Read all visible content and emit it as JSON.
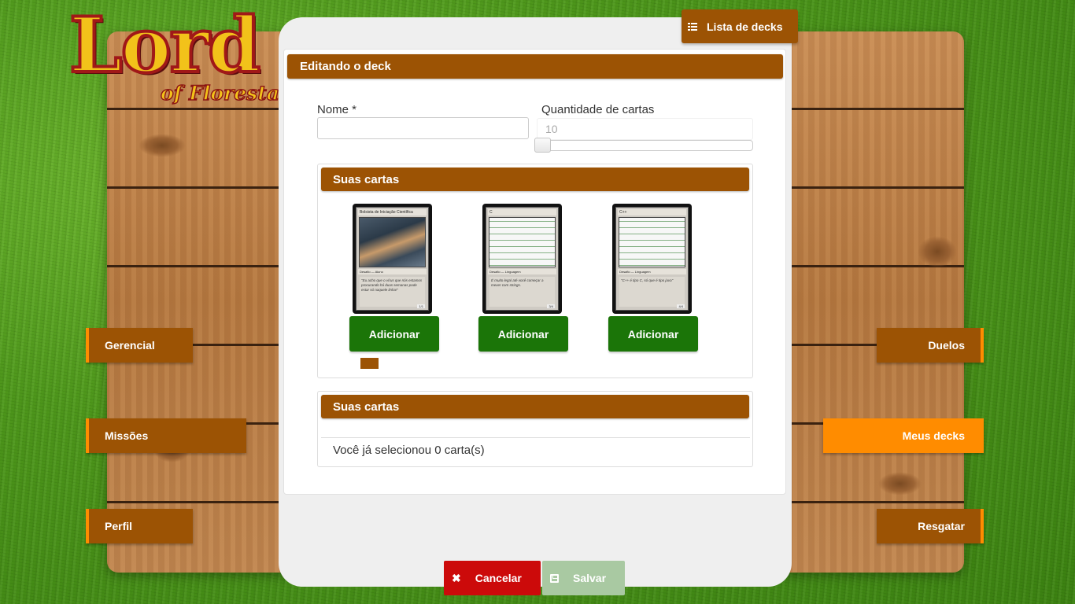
{
  "logo": {
    "main": "Lord",
    "sub": "of Florestal"
  },
  "topbar": {
    "list_decks_label": "Lista de decks",
    "list_icon": "list-icon"
  },
  "form": {
    "header": "Editando o deck",
    "name_label": "Nome *",
    "name_value": "",
    "quantity_label": "Quantidade de cartas",
    "quantity_value": "10",
    "slider_value": 10
  },
  "your_cards": {
    "header": "Suas cartas",
    "add_label": "Adicionar",
    "cards": [
      {
        "title": "Bolsista de Iniciação Científica",
        "type": "Desafio — Aluno",
        "text": "\"Eu acho que o vírus que nós estamos procurando há duas semanas pode estar só naquele linha!\"",
        "num": "1/1",
        "art": "photo"
      },
      {
        "title": "C",
        "type": "Desafio — Linguagem",
        "text": "É muito legal até você começar a mexer com strings.",
        "num": "3/4",
        "art": "code"
      },
      {
        "title": "C++",
        "type": "Desafio — Linguagem",
        "text": "\"C++ é tipo C, só que é tipo java\"",
        "num": "4/4",
        "art": "code"
      }
    ]
  },
  "selected": {
    "header": "Suas cartas",
    "count_text": "Você já selecionou 0 carta(s)"
  },
  "nav_left": [
    "Gerencial",
    "Missões",
    "Perfil"
  ],
  "nav_right": [
    "Duelos",
    "Meus decks",
    "Resgatar"
  ],
  "footer": {
    "cancel_label": "Cancelar",
    "save_label": "Salvar"
  },
  "colors": {
    "brown": "#9c5304",
    "orange": "#ff8c00",
    "green": "#1b7508",
    "red": "#cc0a0a",
    "save_disabled": "#a9c9a2"
  }
}
